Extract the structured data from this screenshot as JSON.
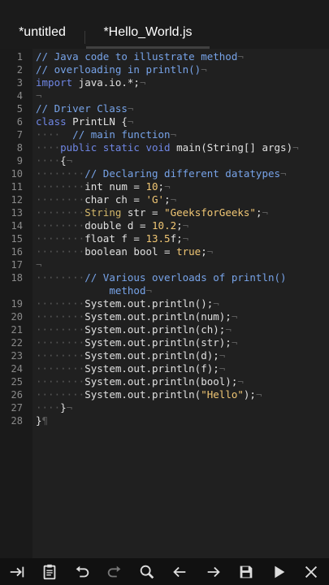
{
  "tabs": [
    {
      "label": "*untitled"
    },
    {
      "label": "*Hello_World.js"
    }
  ],
  "lines": [
    {
      "n": "1",
      "segs": [
        {
          "c": "c",
          "t": "// Java code to illustrate method"
        },
        {
          "c": "p",
          "t": "¬"
        }
      ]
    },
    {
      "n": "2",
      "segs": [
        {
          "c": "c",
          "t": "// overloading in println()"
        },
        {
          "c": "p",
          "t": "¬"
        }
      ]
    },
    {
      "n": "3",
      "segs": [
        {
          "c": "k",
          "t": "import"
        },
        {
          "c": "",
          "t": " java.io.*;"
        },
        {
          "c": "p",
          "t": "¬"
        }
      ]
    },
    {
      "n": "4",
      "segs": [
        {
          "c": "p",
          "t": "¬"
        }
      ]
    },
    {
      "n": "5",
      "segs": [
        {
          "c": "c",
          "t": "// Driver Class"
        },
        {
          "c": "p",
          "t": "¬"
        }
      ]
    },
    {
      "n": "6",
      "segs": [
        {
          "c": "k",
          "t": "class"
        },
        {
          "c": "",
          "t": " PrintLN {"
        },
        {
          "c": "p",
          "t": "¬"
        }
      ]
    },
    {
      "n": "7",
      "segs": [
        {
          "c": "w",
          "t": "····"
        },
        {
          "c": "",
          "t": "  "
        },
        {
          "c": "c",
          "t": "// main function"
        },
        {
          "c": "p",
          "t": "¬"
        }
      ]
    },
    {
      "n": "8",
      "segs": [
        {
          "c": "w",
          "t": "····"
        },
        {
          "c": "k",
          "t": "public static void"
        },
        {
          "c": "",
          "t": " main(String[] args)"
        },
        {
          "c": "p",
          "t": "¬"
        }
      ]
    },
    {
      "n": "9",
      "segs": [
        {
          "c": "w",
          "t": "····"
        },
        {
          "c": "",
          "t": "{"
        },
        {
          "c": "p",
          "t": "¬"
        }
      ]
    },
    {
      "n": "10",
      "segs": [
        {
          "c": "w",
          "t": "········"
        },
        {
          "c": "c",
          "t": "// Declaring different datatypes"
        },
        {
          "c": "p",
          "t": "¬"
        }
      ]
    },
    {
      "n": "11",
      "segs": [
        {
          "c": "w",
          "t": "········"
        },
        {
          "c": "",
          "t": "int num = "
        },
        {
          "c": "s",
          "t": "10"
        },
        {
          "c": "",
          "t": ";"
        },
        {
          "c": "p",
          "t": "¬"
        }
      ]
    },
    {
      "n": "12",
      "segs": [
        {
          "c": "w",
          "t": "········"
        },
        {
          "c": "",
          "t": "char ch = "
        },
        {
          "c": "s",
          "t": "'G'"
        },
        {
          "c": "",
          "t": ";"
        },
        {
          "c": "p",
          "t": "¬"
        }
      ]
    },
    {
      "n": "13",
      "segs": [
        {
          "c": "w",
          "t": "········"
        },
        {
          "c": "t",
          "t": "String"
        },
        {
          "c": "",
          "t": " str = "
        },
        {
          "c": "s",
          "t": "\"GeeksforGeeks\""
        },
        {
          "c": "",
          "t": ";"
        },
        {
          "c": "p",
          "t": "¬"
        }
      ]
    },
    {
      "n": "14",
      "segs": [
        {
          "c": "w",
          "t": "········"
        },
        {
          "c": "",
          "t": "double d = "
        },
        {
          "c": "s",
          "t": "10.2"
        },
        {
          "c": "",
          "t": ";"
        },
        {
          "c": "p",
          "t": "¬"
        }
      ]
    },
    {
      "n": "15",
      "segs": [
        {
          "c": "w",
          "t": "········"
        },
        {
          "c": "",
          "t": "float f = "
        },
        {
          "c": "s",
          "t": "13.5"
        },
        {
          "c": "",
          "t": "f;"
        },
        {
          "c": "p",
          "t": "¬"
        }
      ]
    },
    {
      "n": "16",
      "segs": [
        {
          "c": "w",
          "t": "········"
        },
        {
          "c": "",
          "t": "boolean bool = "
        },
        {
          "c": "s",
          "t": "true"
        },
        {
          "c": "",
          "t": ";"
        },
        {
          "c": "p",
          "t": "¬"
        }
      ]
    },
    {
      "n": "17",
      "segs": [
        {
          "c": "p",
          "t": "¬"
        }
      ]
    },
    {
      "n": "18",
      "segs": [
        {
          "c": "w",
          "t": "········"
        },
        {
          "c": "c",
          "t": "// Various overloads of println()"
        }
      ]
    },
    {
      "n": "",
      "segs": [
        {
          "c": "",
          "t": "            "
        },
        {
          "c": "c",
          "t": "method"
        },
        {
          "c": "p",
          "t": "¬"
        }
      ]
    },
    {
      "n": "19",
      "segs": [
        {
          "c": "w",
          "t": "········"
        },
        {
          "c": "",
          "t": "System.out.println();"
        },
        {
          "c": "p",
          "t": "¬"
        }
      ]
    },
    {
      "n": "20",
      "segs": [
        {
          "c": "w",
          "t": "········"
        },
        {
          "c": "",
          "t": "System.out.println(num);"
        },
        {
          "c": "p",
          "t": "¬"
        }
      ]
    },
    {
      "n": "21",
      "segs": [
        {
          "c": "w",
          "t": "········"
        },
        {
          "c": "",
          "t": "System.out.println(ch);"
        },
        {
          "c": "p",
          "t": "¬"
        }
      ]
    },
    {
      "n": "22",
      "segs": [
        {
          "c": "w",
          "t": "········"
        },
        {
          "c": "",
          "t": "System.out.println(str);"
        },
        {
          "c": "p",
          "t": "¬"
        }
      ]
    },
    {
      "n": "23",
      "segs": [
        {
          "c": "w",
          "t": "········"
        },
        {
          "c": "",
          "t": "System.out.println(d);"
        },
        {
          "c": "p",
          "t": "¬"
        }
      ]
    },
    {
      "n": "24",
      "segs": [
        {
          "c": "w",
          "t": "········"
        },
        {
          "c": "",
          "t": "System.out.println(f);"
        },
        {
          "c": "p",
          "t": "¬"
        }
      ]
    },
    {
      "n": "25",
      "segs": [
        {
          "c": "w",
          "t": "········"
        },
        {
          "c": "",
          "t": "System.out.println(bool);"
        },
        {
          "c": "p",
          "t": "¬"
        }
      ]
    },
    {
      "n": "26",
      "segs": [
        {
          "c": "w",
          "t": "········"
        },
        {
          "c": "",
          "t": "System.out.println("
        },
        {
          "c": "s",
          "t": "\"Hello\""
        },
        {
          "c": "",
          "t": ");"
        },
        {
          "c": "p",
          "t": "¬"
        }
      ]
    },
    {
      "n": "27",
      "segs": [
        {
          "c": "w",
          "t": "····"
        },
        {
          "c": "",
          "t": "}"
        },
        {
          "c": "p",
          "t": "¬"
        }
      ]
    },
    {
      "n": "28",
      "segs": [
        {
          "c": "",
          "t": "}"
        },
        {
          "c": "p",
          "t": "¶"
        }
      ]
    }
  ],
  "toolbar": [
    {
      "name": "indent-icon"
    },
    {
      "name": "clipboard-icon"
    },
    {
      "name": "undo-icon"
    },
    {
      "name": "redo-icon"
    },
    {
      "name": "search-icon"
    },
    {
      "name": "arrow-left-icon"
    },
    {
      "name": "arrow-right-icon"
    },
    {
      "name": "save-icon"
    },
    {
      "name": "play-icon"
    },
    {
      "name": "close-icon"
    }
  ],
  "colors": {
    "background": "#202020",
    "comment": "#77a3e8",
    "keyword": "#6f86e4",
    "string": "#f0c674",
    "type": "#d4b86a"
  }
}
